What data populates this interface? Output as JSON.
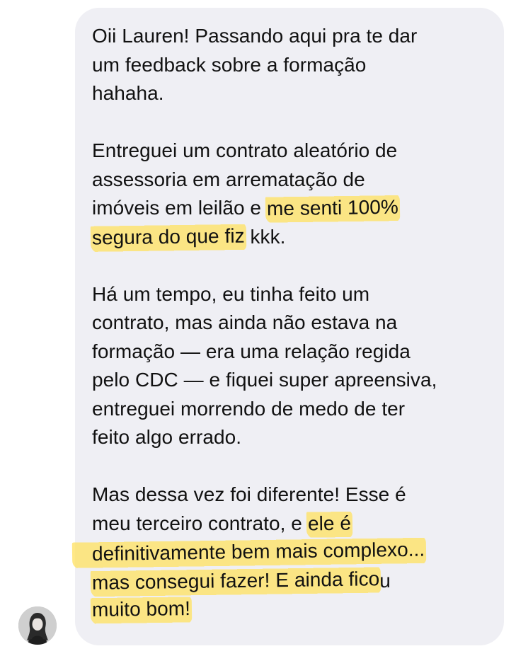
{
  "message": {
    "p1": {
      "l1": "Oii Lauren! Passando aqui pra te dar",
      "l2": "um feedback sobre a formação",
      "l3": "hahaha."
    },
    "p2": {
      "l1": "Entreguei um contrato aleatório de",
      "l2": "assessoria em arrematação de",
      "l3_pre": "imóveis em leilão e ",
      "l3_hl": "me senti 100%",
      "l4_hl": "segura do que fiz",
      "l4_post": " kkk."
    },
    "p3": {
      "l1": "Há um tempo, eu tinha feito um",
      "l2": "contrato, mas ainda não estava na",
      "l3": "formação — era uma relação regida",
      "l4": "pelo CDC — e fiquei super apreensiva,",
      "l5": "entreguei morrendo de medo de ter",
      "l6": "feito algo errado."
    },
    "p4": {
      "l1": "Mas dessa vez foi diferente! Esse é",
      "l2_pre": "meu terceiro contrato, e ",
      "l2_hl": "ele é",
      "l3_hl": "definitivamente bem mais complexo...",
      "l4_hl": "mas consegui fazer! E ainda fico",
      "l4_post": "u",
      "l5_hl": "muito bom!"
    }
  },
  "colors": {
    "bubble": "#efeff4",
    "text": "#111111",
    "highlight": "#ffe264"
  },
  "icons": {
    "avatar": "profile-photo-avatar"
  }
}
